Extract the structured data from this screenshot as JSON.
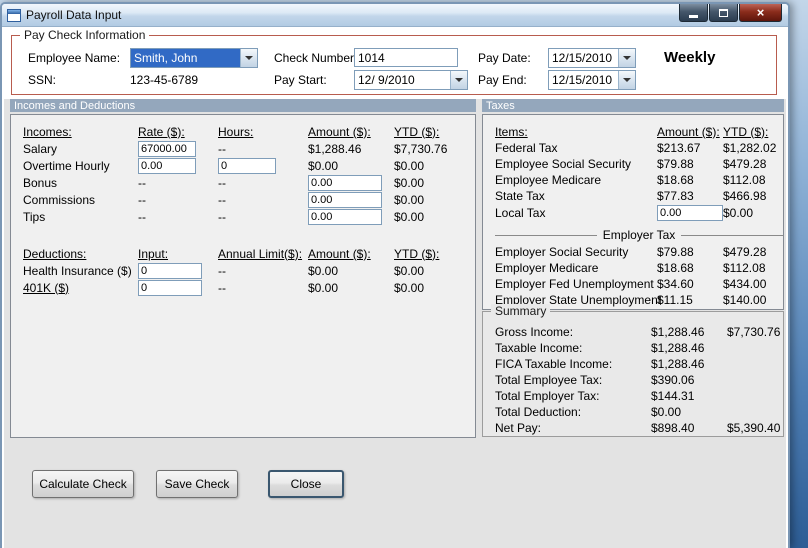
{
  "window": {
    "title": "Payroll Data Input",
    "controls": {
      "close_glyph": "×"
    }
  },
  "paycheck": {
    "group_label": "Pay Check Information",
    "employee_name": {
      "label": "Employee Name:",
      "value": "Smith, John"
    },
    "ssn": {
      "label": "SSN:",
      "value": "123-45-6789"
    },
    "check_number": {
      "label": "Check Number:",
      "value": "1014"
    },
    "pay_start": {
      "label": "Pay Start:",
      "value": "12/ 9/2010"
    },
    "pay_date": {
      "label": "Pay Date:",
      "value": "12/15/2010"
    },
    "pay_end": {
      "label": "Pay End:",
      "value": "12/15/2010"
    },
    "frequency": "Weekly"
  },
  "panels": {
    "incomes_header": "Incomes and Deductions",
    "taxes_header": "Taxes"
  },
  "incomes": {
    "headers": {
      "c1": "Incomes:",
      "c2": "Rate ($):",
      "c3": "Hours:",
      "c4": "Amount ($):",
      "c5": "YTD ($):"
    },
    "rows": [
      {
        "label": "Salary",
        "rate": "67000.00",
        "hours": "--",
        "amount": "$1,288.46",
        "ytd": "$7,730.76"
      },
      {
        "label": "Overtime Hourly",
        "rate": "0.00",
        "hours": "0",
        "amount": "$0.00",
        "ytd": "$0.00"
      },
      {
        "label": "Bonus",
        "rate": "--",
        "hours": "--",
        "amount": "0.00",
        "ytd": "$0.00"
      },
      {
        "label": "Commissions",
        "rate": "--",
        "hours": "--",
        "amount": "0.00",
        "ytd": "$0.00"
      },
      {
        "label": "Tips",
        "rate": "--",
        "hours": "--",
        "amount": "0.00",
        "ytd": "$0.00"
      }
    ]
  },
  "deductions": {
    "headers": {
      "c1": "Deductions:",
      "c2": "Input:",
      "c3": "Annual Limit($):",
      "c4": "Amount ($):",
      "c5": "YTD ($):"
    },
    "rows": [
      {
        "label": "Health Insurance  ($)",
        "input": "0",
        "limit": "--",
        "amount": "$0.00",
        "ytd": "$0.00"
      },
      {
        "label": "401K  ($)",
        "input": "0",
        "limit": "--",
        "amount": "$0.00",
        "ytd": "$0.00"
      }
    ]
  },
  "taxes": {
    "headers": {
      "items": "Items:",
      "amount": "Amount ($):",
      "ytd": "YTD ($):"
    },
    "employee_rows": [
      {
        "label": "Federal Tax",
        "amount": "$213.67",
        "ytd": "$1,282.02"
      },
      {
        "label": "Employee Social Security",
        "amount": "$79.88",
        "ytd": "$479.28"
      },
      {
        "label": "Employee Medicare",
        "amount": "$18.68",
        "ytd": "$112.08"
      },
      {
        "label": "State Tax",
        "amount": "$77.83",
        "ytd": "$466.98"
      },
      {
        "label": "Local Tax",
        "amount": "0.00",
        "ytd": "$0.00"
      }
    ],
    "employer_header": "Employer Tax",
    "employer_rows": [
      {
        "label": "Employer Social Security",
        "amount": "$79.88",
        "ytd": "$479.28"
      },
      {
        "label": "Employer Medicare",
        "amount": "$18.68",
        "ytd": "$112.08"
      },
      {
        "label": "Employer Fed Unemployment",
        "amount": "$34.60",
        "ytd": "$434.00"
      },
      {
        "label": "Employer State Unemployment",
        "amount": "$11.15",
        "ytd": "$140.00"
      }
    ]
  },
  "summary": {
    "group_label": "Summary",
    "rows": [
      {
        "label": "Gross Income:",
        "amount": "$1,288.46",
        "ytd": "$7,730.76"
      },
      {
        "label": "Taxable Income:",
        "amount": "$1,288.46",
        "ytd": ""
      },
      {
        "label": "FICA Taxable Income:",
        "amount": "$1,288.46",
        "ytd": ""
      },
      {
        "label": "Total Employee Tax:",
        "amount": "$390.06",
        "ytd": ""
      },
      {
        "label": "Total Employer Tax:",
        "amount": "$144.31",
        "ytd": ""
      },
      {
        "label": "Total Deduction:",
        "amount": "$0.00",
        "ytd": ""
      },
      {
        "label": "Net Pay:",
        "amount": "$898.40",
        "ytd": "$5,390.40"
      }
    ]
  },
  "buttons": {
    "calculate": "Calculate Check",
    "save": "Save Check",
    "close": "Close"
  }
}
